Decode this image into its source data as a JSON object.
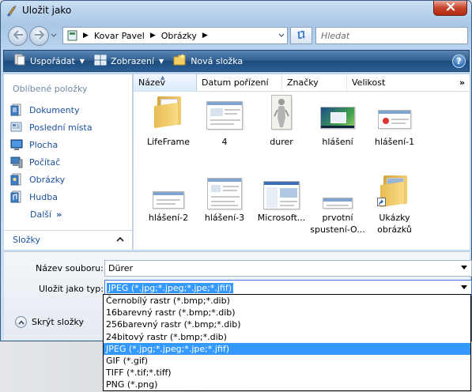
{
  "window": {
    "title": "Uložit jako"
  },
  "address": {
    "segments": [
      "Kovar Pavel",
      "Obrázky"
    ],
    "search_placeholder": "Hledat"
  },
  "toolbar": {
    "organize": "Uspořádat",
    "views": "Zobrazení",
    "new_folder": "Nová složka",
    "help": "?"
  },
  "navpane": {
    "heading": "Oblíbené položky",
    "items": [
      {
        "label": "Dokumenty",
        "icon": "documents-icon"
      },
      {
        "label": "Poslední místa",
        "icon": "recent-places-icon"
      },
      {
        "label": "Plocha",
        "icon": "desktop-icon"
      },
      {
        "label": "Počítač",
        "icon": "computer-icon"
      },
      {
        "label": "Obrázky",
        "icon": "pictures-icon"
      },
      {
        "label": "Hudba",
        "icon": "music-icon"
      }
    ],
    "more": "Další",
    "folders": "Složky"
  },
  "columns": [
    "Název",
    "Datum pořízení",
    "Značky",
    "Velikost"
  ],
  "files": [
    {
      "name": "LifeFrame",
      "kind": "folder"
    },
    {
      "name": "4",
      "kind": "screenshot"
    },
    {
      "name": "durer",
      "kind": "drawing"
    },
    {
      "name": "hlášení",
      "kind": "desktop"
    },
    {
      "name": "hlášení-1",
      "kind": "dialog"
    },
    {
      "name": "hlášení-2",
      "kind": "small-dialog"
    },
    {
      "name": "hlášení-3",
      "kind": "screenshot"
    },
    {
      "name": "Microsoft...",
      "kind": "screenshot"
    },
    {
      "name": "prvotní spustení-O...",
      "kind": "small-dialog"
    },
    {
      "name": "Ukázky obrázků",
      "kind": "shortcut-folder"
    }
  ],
  "form": {
    "filename_label": "Název souboru:",
    "filename_value": "Dürer",
    "filetype_label": "Uložit jako typ:",
    "filetype_value": "JPEG (*.jpg;*.jpeg;*.jpe;*.jfif)",
    "hide_folders": "Skrýt složky"
  },
  "filetype_options": [
    "Černobílý rastr (*.bmp;*.dib)",
    "16barevný rastr (*.bmp;*.dib)",
    "256barevný rastr (*.bmp;*.dib)",
    "24bitový rastr (*.bmp;*.dib)",
    "JPEG (*.jpg;*.jpeg;*.jpe;*.jfif)",
    "GIF (*.gif)",
    "TIFF (*.tif;*.tiff)",
    "PNG (*.png)"
  ],
  "filetype_selected_index": 4
}
